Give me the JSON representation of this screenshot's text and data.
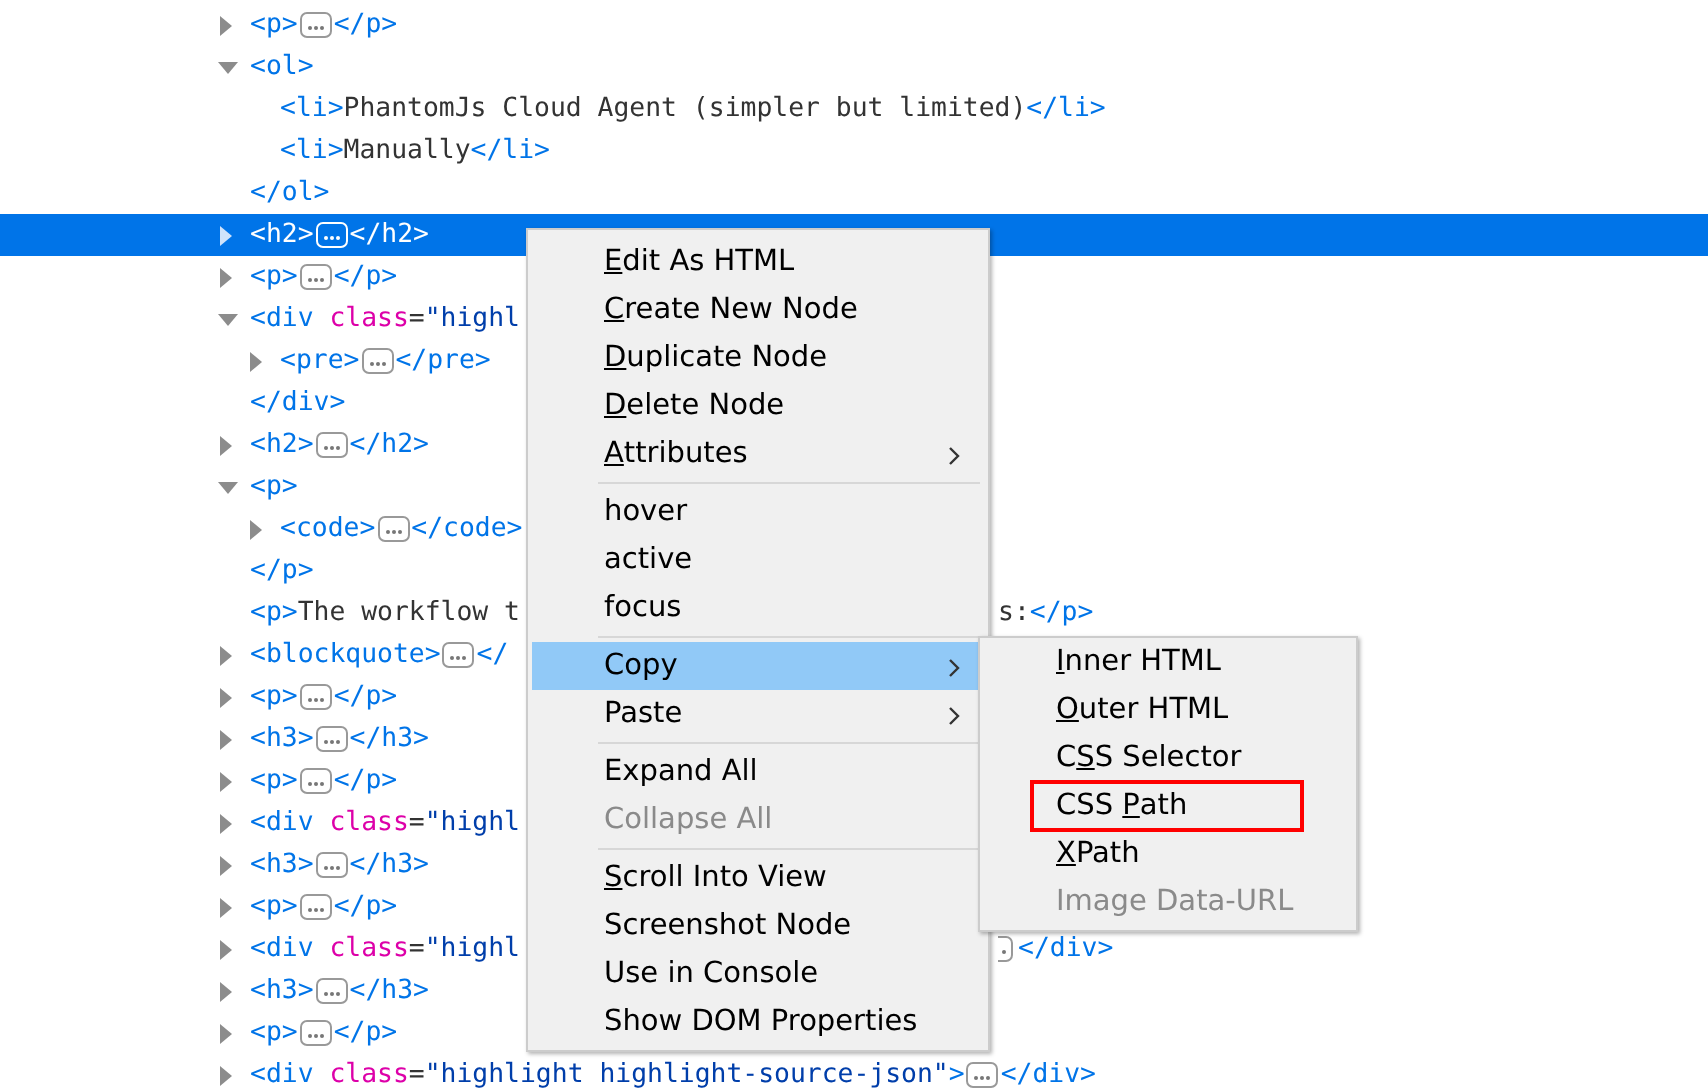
{
  "tree": [
    {
      "expanded": false,
      "open": [
        {
          "kind": "tag",
          "text": "<p>"
        },
        {
          "kind": "more"
        },
        {
          "kind": "tag",
          "text": "</p>"
        }
      ]
    },
    {
      "expanded": true,
      "open": [
        {
          "kind": "tag",
          "text": "<ol>"
        }
      ],
      "children": [
        {
          "open": [
            {
              "kind": "tag",
              "text": "<li>"
            },
            {
              "kind": "text",
              "text": "PhantomJs Cloud Agent (simpler but limited)"
            },
            {
              "kind": "tag",
              "text": "</li>"
            }
          ]
        },
        {
          "open": [
            {
              "kind": "tag",
              "text": "<li>"
            },
            {
              "kind": "text",
              "text": "Manually"
            },
            {
              "kind": "tag",
              "text": "</li>"
            }
          ]
        }
      ],
      "close": [
        {
          "kind": "tag",
          "text": "</ol>"
        }
      ]
    },
    {
      "expanded": false,
      "selected": true,
      "open": [
        {
          "kind": "tag",
          "text": "<h2>"
        },
        {
          "kind": "more"
        },
        {
          "kind": "tag",
          "text": "</h2>"
        }
      ]
    },
    {
      "expanded": false,
      "open": [
        {
          "kind": "tag",
          "text": "<p>"
        },
        {
          "kind": "more"
        },
        {
          "kind": "tag",
          "text": "</p>"
        }
      ]
    },
    {
      "expanded": true,
      "open": [
        {
          "kind": "tag",
          "text": "<div"
        },
        {
          "kind": "attr",
          "text": " class"
        },
        {
          "kind": "text",
          "text": "="
        },
        {
          "kind": "value",
          "text": "\"highl"
        }
      ],
      "children": [
        {
          "expanded": false,
          "open": [
            {
              "kind": "tag",
              "text": "<pre>"
            },
            {
              "kind": "more"
            },
            {
              "kind": "tag",
              "text": "</pre>"
            }
          ]
        }
      ],
      "close": [
        {
          "kind": "tag",
          "text": "</div>"
        }
      ]
    },
    {
      "expanded": false,
      "open": [
        {
          "kind": "tag",
          "text": "<h2>"
        },
        {
          "kind": "more"
        },
        {
          "kind": "tag",
          "text": "</h2>"
        }
      ]
    },
    {
      "expanded": true,
      "open": [
        {
          "kind": "tag",
          "text": "<p>"
        }
      ],
      "children": [
        {
          "expanded": false,
          "open": [
            {
              "kind": "tag",
              "text": "<code>"
            },
            {
              "kind": "more"
            },
            {
              "kind": "tag",
              "text": "</code>"
            }
          ]
        }
      ],
      "close": [
        {
          "kind": "tag",
          "text": "</p>"
        }
      ]
    },
    {
      "open": [
        {
          "kind": "tag",
          "text": "<p>"
        },
        {
          "kind": "text",
          "text": "The workflow t"
        }
      ],
      "tail": [
        {
          "kind": "text",
          "text": "s:"
        },
        {
          "kind": "tag",
          "text": "</p>"
        }
      ]
    },
    {
      "expanded": false,
      "open": [
        {
          "kind": "tag",
          "text": "<blockquote>"
        },
        {
          "kind": "more"
        },
        {
          "kind": "tag",
          "text": "</"
        }
      ]
    },
    {
      "expanded": false,
      "open": [
        {
          "kind": "tag",
          "text": "<p>"
        },
        {
          "kind": "more"
        },
        {
          "kind": "tag",
          "text": "</p>"
        }
      ]
    },
    {
      "expanded": false,
      "open": [
        {
          "kind": "tag",
          "text": "<h3>"
        },
        {
          "kind": "more"
        },
        {
          "kind": "tag",
          "text": "</h3>"
        }
      ]
    },
    {
      "expanded": false,
      "open": [
        {
          "kind": "tag",
          "text": "<p>"
        },
        {
          "kind": "more"
        },
        {
          "kind": "tag",
          "text": "</p>"
        }
      ]
    },
    {
      "expanded": false,
      "open": [
        {
          "kind": "tag",
          "text": "<div"
        },
        {
          "kind": "attr",
          "text": " class"
        },
        {
          "kind": "text",
          "text": "="
        },
        {
          "kind": "value",
          "text": "\"highl"
        }
      ]
    },
    {
      "expanded": false,
      "open": [
        {
          "kind": "tag",
          "text": "<h3>"
        },
        {
          "kind": "more"
        },
        {
          "kind": "tag",
          "text": "</h3>"
        }
      ]
    },
    {
      "expanded": false,
      "open": [
        {
          "kind": "tag",
          "text": "<p>"
        },
        {
          "kind": "more"
        },
        {
          "kind": "tag",
          "text": "</p>"
        }
      ]
    },
    {
      "expanded": false,
      "open": [
        {
          "kind": "tag",
          "text": "<div"
        },
        {
          "kind": "attr",
          "text": " class"
        },
        {
          "kind": "text",
          "text": "="
        },
        {
          "kind": "value",
          "text": "\"highl"
        }
      ],
      "tail": [
        {
          "kind": "cut"
        },
        {
          "kind": "tag",
          "text": "</div>"
        }
      ]
    },
    {
      "expanded": false,
      "open": [
        {
          "kind": "tag",
          "text": "<h3>"
        },
        {
          "kind": "more"
        },
        {
          "kind": "tag",
          "text": "</h3>"
        }
      ]
    },
    {
      "expanded": false,
      "open": [
        {
          "kind": "tag",
          "text": "<p>"
        },
        {
          "kind": "more"
        },
        {
          "kind": "tag",
          "text": "</p>"
        }
      ]
    },
    {
      "expanded": false,
      "open": [
        {
          "kind": "tag",
          "text": "<div"
        },
        {
          "kind": "attr",
          "text": " class"
        },
        {
          "kind": "text",
          "text": "="
        },
        {
          "kind": "value",
          "text": "\"highlight highlight-source-json\""
        },
        {
          "kind": "tag",
          "text": ">"
        },
        {
          "kind": "more"
        },
        {
          "kind": "tag",
          "text": "</div>"
        }
      ]
    }
  ],
  "context_menu": [
    {
      "kind": "item",
      "key": "E",
      "after": "dit As HTML"
    },
    {
      "kind": "item",
      "key": "C",
      "after": "reate New Node"
    },
    {
      "kind": "item",
      "key": "D",
      "after": "uplicate Node"
    },
    {
      "kind": "item",
      "key": "D",
      "after": "elete Node"
    },
    {
      "kind": "item",
      "key": "A",
      "after": "ttributes",
      "submenu": true
    },
    {
      "kind": "separator"
    },
    {
      "kind": "item",
      "before": "hover"
    },
    {
      "kind": "item",
      "before": "active"
    },
    {
      "kind": "item",
      "before": "focus"
    },
    {
      "kind": "separator"
    },
    {
      "kind": "item",
      "before": "Copy",
      "submenu": true,
      "selected": true
    },
    {
      "kind": "item",
      "before": "Paste",
      "submenu": true
    },
    {
      "kind": "separator"
    },
    {
      "kind": "item",
      "before": "Expand All"
    },
    {
      "kind": "item",
      "before": "Collapse All",
      "disabled": true
    },
    {
      "kind": "separator"
    },
    {
      "kind": "item",
      "key": "S",
      "after": "croll Into View"
    },
    {
      "kind": "item",
      "before": "Screenshot Node"
    },
    {
      "kind": "item",
      "before": "Use in Console"
    },
    {
      "kind": "item",
      "before": "Show DOM Properties"
    }
  ],
  "copy_submenu": [
    {
      "key": "I",
      "after": "nner HTML"
    },
    {
      "key": "O",
      "after": "uter HTML"
    },
    {
      "before": "C",
      "key": "S",
      "after": "S Selector"
    },
    {
      "before": "CSS ",
      "key": "P",
      "after": "ath",
      "highlighted": true
    },
    {
      "key": "X",
      "after": "Path"
    },
    {
      "before": "Image Data-URL",
      "disabled": true
    }
  ]
}
